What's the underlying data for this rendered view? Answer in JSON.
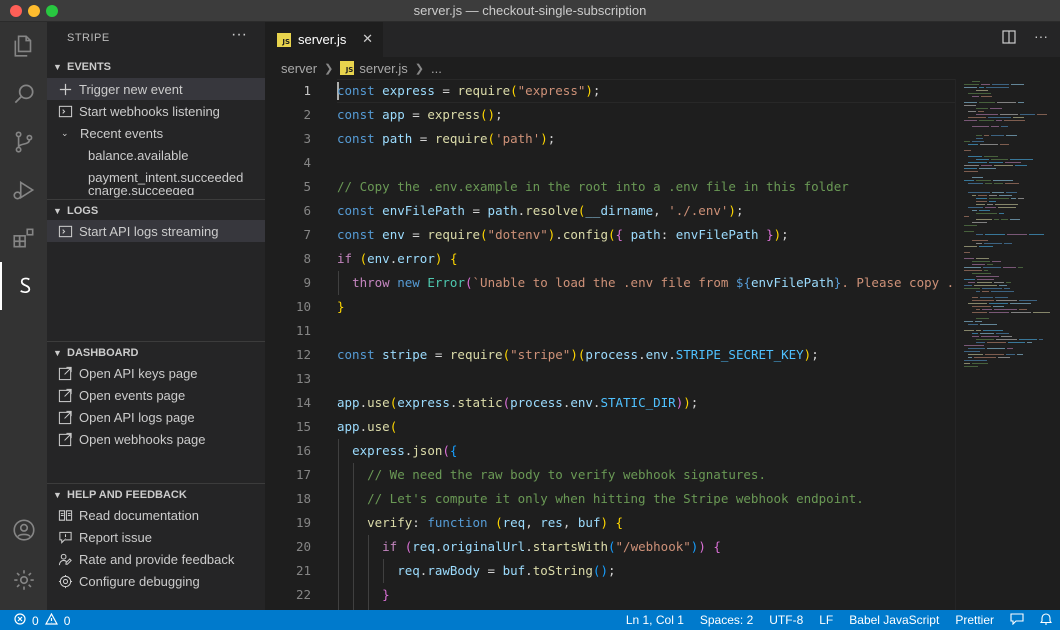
{
  "window": {
    "title": "server.js — checkout-single-subscription"
  },
  "sidebar": {
    "title": "STRIPE",
    "more": "···",
    "events": {
      "header": "EVENTS",
      "items": [
        "Trigger new event",
        "Start webhooks listening",
        "Recent events"
      ],
      "recent": [
        "balance.available",
        "payment_intent.succeeded",
        "charge.succeeded"
      ]
    },
    "logs": {
      "header": "LOGS",
      "items": [
        "Start API logs streaming"
      ]
    },
    "dashboard": {
      "header": "DASHBOARD",
      "items": [
        "Open API keys page",
        "Open events page",
        "Open API logs page",
        "Open webhooks page"
      ]
    },
    "help": {
      "header": "HELP AND FEEDBACK",
      "items": [
        "Read documentation",
        "Report issue",
        "Rate and provide feedback",
        "Configure debugging"
      ]
    }
  },
  "editor": {
    "tab": {
      "label": "server.js",
      "badge": "JS"
    },
    "breadcrumb": [
      "server",
      "server.js",
      "..."
    ],
    "line_numbers": [
      "1",
      "2",
      "3",
      "4",
      "5",
      "6",
      "7",
      "8",
      "9",
      "10",
      "11",
      "12",
      "13",
      "14",
      "15",
      "16",
      "17",
      "18",
      "19",
      "20",
      "21",
      "22"
    ]
  },
  "statusbar": {
    "errors": "0",
    "warnings": "0",
    "position": "Ln 1, Col 1",
    "spaces": "Spaces: 2",
    "encoding": "UTF-8",
    "eol": "LF",
    "language": "Babel JavaScript",
    "formatter": "Prettier"
  },
  "colors": {
    "accent": "#007acc",
    "activity_bar": "#333333",
    "sidebar": "#252526",
    "editor": "#1e1e1e"
  }
}
